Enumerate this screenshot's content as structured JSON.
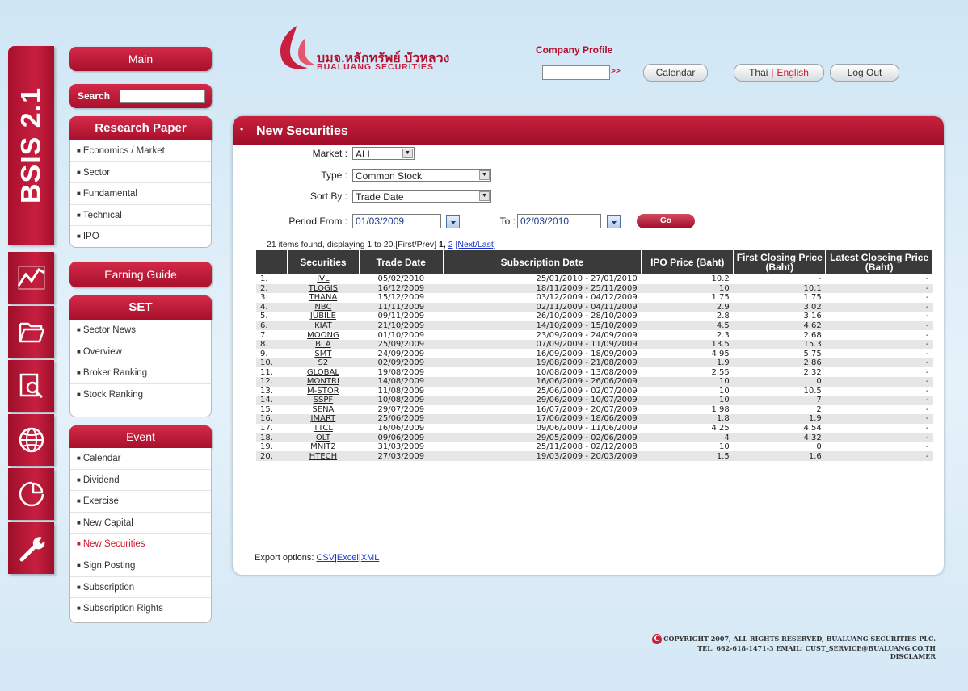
{
  "brand": {
    "app_name": "BSIS 2.1",
    "logo_thai": "บมจ.หลักทรัพย์ บัวหลวง",
    "logo_english": "BUALUANG SECURITIES",
    "accent_color": "#c81f3f"
  },
  "rail": {
    "icons": [
      "chart-icon",
      "folder-icon",
      "report-search-icon",
      "globe-icon",
      "pie-chart-icon",
      "wrench-icon"
    ]
  },
  "sidebar": {
    "main_label": "Main",
    "search_label": "Search",
    "search_value": "",
    "research_title": "Research Paper",
    "research_items": [
      "Economics / Market",
      "Sector",
      "Fundamental",
      "Technical",
      "IPO"
    ],
    "earning_title": "Earning Guide",
    "set_title": "SET",
    "set_items": [
      "Sector News",
      "Overview",
      "Broker Ranking",
      "Stock Ranking"
    ],
    "event_title": "Event",
    "event_items": [
      "Calendar",
      "Dividend",
      "Exercise",
      "New Capital",
      "New Securities",
      "Sign Posting",
      "Subscription",
      "Subscription Rights"
    ],
    "active_item": "New Securities"
  },
  "header": {
    "company_profile_label": "Company Profile",
    "company_profile_value": "",
    "go_arrows": ">>",
    "calendar_label": "Calendar",
    "lang_thai": "Thai",
    "lang_separator": "|",
    "lang_english": "English",
    "logout_label": "Log Out"
  },
  "page": {
    "title": "New Securities",
    "bullet": "•"
  },
  "filters": {
    "market_label": "Market :",
    "market_value": "ALL",
    "type_label": "Type :",
    "type_value": "Common Stock",
    "sortby_label": "Sort By :",
    "sortby_value": "Trade Date",
    "period_from_label": "Period From :",
    "period_from_value": "01/03/2009",
    "to_label": "To :",
    "to_value": "02/03/2010",
    "go_label": "Go"
  },
  "results": {
    "summary": "21 items found, displaying 1 to 20.[First/Prev]",
    "current_page": "1,",
    "page2": "2",
    "next_last": "[Next/Last]"
  },
  "table": {
    "columns": [
      "",
      "Securities",
      "Trade Date",
      "Subscription Date",
      "IPO Price (Baht)",
      "First Closing Price (Baht)",
      "Latest Closeing Price (Baht)"
    ],
    "rows": [
      [
        "1.",
        "IVL",
        "05/02/2010",
        "25/01/2010 - 27/01/2010",
        "10.2",
        "-",
        "-"
      ],
      [
        "2.",
        "TLOGIS",
        "16/12/2009",
        "18/11/2009 - 25/11/2009",
        "10",
        "10.1",
        "-"
      ],
      [
        "3.",
        "THANA",
        "15/12/2009",
        "03/12/2009 - 04/12/2009",
        "1.75",
        "1.75",
        "-"
      ],
      [
        "4.",
        "NBC",
        "11/11/2009",
        "02/11/2009 - 04/11/2009",
        "2.9",
        "3.02",
        "-"
      ],
      [
        "5.",
        "JUBILE",
        "09/11/2009",
        "26/10/2009 - 28/10/2009",
        "2.8",
        "3.16",
        "-"
      ],
      [
        "6.",
        "KIAT",
        "21/10/2009",
        "14/10/2009 - 15/10/2009",
        "4.5",
        "4.62",
        "-"
      ],
      [
        "7.",
        "MOONG",
        "01/10/2009",
        "23/09/2009 - 24/09/2009",
        "2.3",
        "2.68",
        "-"
      ],
      [
        "8.",
        "BLA",
        "25/09/2009",
        "07/09/2009 - 11/09/2009",
        "13.5",
        "15.3",
        "-"
      ],
      [
        "9.",
        "SMT",
        "24/09/2009",
        "16/09/2009 - 18/09/2009",
        "4.95",
        "5.75",
        "-"
      ],
      [
        "10.",
        "S2",
        "02/09/2009",
        "19/08/2009 - 21/08/2009",
        "1.9",
        "2.86",
        "-"
      ],
      [
        "11.",
        "GLOBAL",
        "19/08/2009",
        "10/08/2009 - 13/08/2009",
        "2.55",
        "2.32",
        "-"
      ],
      [
        "12.",
        "MONTRI",
        "14/08/2009",
        "16/06/2009 - 26/06/2009",
        "10",
        "0",
        "-"
      ],
      [
        "13.",
        "M-STOR",
        "11/08/2009",
        "25/06/2009 - 02/07/2009",
        "10",
        "10.5",
        "-"
      ],
      [
        "14.",
        "SSPF",
        "10/08/2009",
        "29/06/2009 - 10/07/2009",
        "10",
        "7",
        "-"
      ],
      [
        "15.",
        "SENA",
        "29/07/2009",
        "16/07/2009 - 20/07/2009",
        "1.98",
        "2",
        "-"
      ],
      [
        "16.",
        "JMART",
        "25/06/2009",
        "17/06/2009 - 18/06/2009",
        "1.8",
        "1.9",
        "-"
      ],
      [
        "17.",
        "TTCL",
        "16/06/2009",
        "09/06/2009 - 11/06/2009",
        "4.25",
        "4.54",
        "-"
      ],
      [
        "18.",
        "OLT",
        "09/06/2009",
        "29/05/2009 - 02/06/2009",
        "4",
        "4.32",
        "-"
      ],
      [
        "19.",
        "MNIT2",
        "31/03/2009",
        "25/11/2008 - 02/12/2008",
        "10",
        "0",
        "-"
      ],
      [
        "20.",
        "HTECH",
        "27/03/2009",
        "19/03/2009 - 20/03/2009",
        "1.5",
        "1.6",
        "-"
      ]
    ]
  },
  "export": {
    "label": "Export options:",
    "csv": "CSV",
    "excel": "Excel",
    "xml": "XML",
    "separator": "|"
  },
  "footer": {
    "line1": "COPYRIGHT 2007, ALL RIGHTS RESERVED, BUALUANG SECURITIES PLC.",
    "line2": "TEL. 662-618-1471-3 EMAIL: CUST_SERVICE@BUALUANG.CO.TH",
    "line3": "DISCLAMER"
  }
}
